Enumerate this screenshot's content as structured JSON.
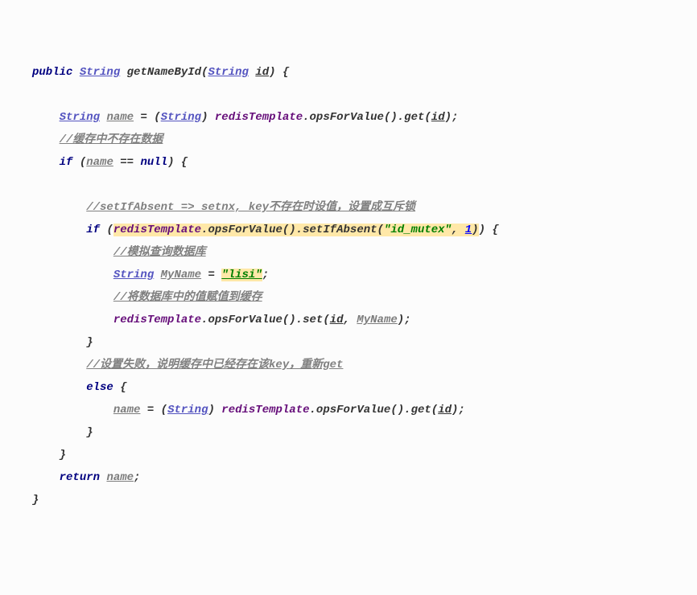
{
  "code": {
    "l1_public": "public",
    "l1_type": "String",
    "l1_method": "getNameById",
    "l1_ptype": "String",
    "l1_pname": "id",
    "l3_type": "String",
    "l3_name": "name",
    "l3_cast": "String",
    "l3_obj": "redisTemplate",
    "l3_m1": "opsForValue",
    "l3_m2": "get",
    "l3_arg": "id",
    "l4_comment": "//缓存中不存在数据",
    "l5_if": "if",
    "l5_name": "name",
    "l5_op": "==",
    "l5_null": "null",
    "l7_comment": "//setIfAbsent => setnx, key不存在时设值，设置成互斥锁",
    "l8_if": "if",
    "l8_obj": "redisTemplate",
    "l8_m1": "opsForValue",
    "l8_m2": "setIfAbsent",
    "l8_arg1": "\"id_mutex\"",
    "l8_arg2": "1",
    "l9_comment": "//模拟查询数据库",
    "l10_type": "String",
    "l10_name": "MyName",
    "l10_val": "\"lisi\"",
    "l11_comment": "//将数据库中的值赋值到缓存",
    "l12_obj": "redisTemplate",
    "l12_m1": "opsForValue",
    "l12_m2": "set",
    "l12_arg1": "id",
    "l12_arg2": "MyName",
    "l14_comment": "//设置失败，说明缓存中已经存在该key，重新get",
    "l15_else": "else",
    "l16_name": "name",
    "l16_cast": "String",
    "l16_obj": "redisTemplate",
    "l16_m1": "opsForValue",
    "l16_m2": "get",
    "l16_arg": "id",
    "l19_return": "return",
    "l19_name": "name"
  }
}
